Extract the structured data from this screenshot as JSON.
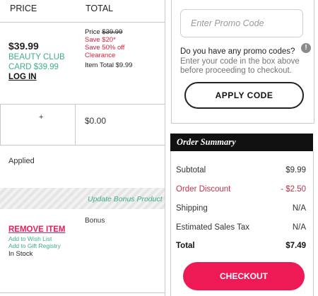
{
  "cart": {
    "headers": {
      "price": "PRICE",
      "total": "TOTAL"
    },
    "item": {
      "sale_price": "$39.99",
      "beauty_club_label": "BEAUTY CLUB",
      "beauty_club_card": "CARD $39.99",
      "login_link": "LOG IN",
      "detail_price_label": "Price",
      "detail_price": "$39.99",
      "save_amount": "Save $20*",
      "save_percent": "Save 50% off",
      "clearance": "Clearance",
      "item_total": "Item Total $9.99"
    },
    "qty_plus": "+",
    "row_total": "$0.00",
    "applied": "Applied",
    "update_bonus": "Update Bonus Product",
    "bonus_label": "Bonus",
    "remove_item": "REMOVE ITEM",
    "add_wish": "Add to Wish List",
    "add_registry": "Add to Gift Registry",
    "stock": "In Stock"
  },
  "promo": {
    "placeholder": "Enter Promo Code",
    "question": "Do you have any promo codes?",
    "info_glyph": "!",
    "help_line1": "Enter your code in the box above",
    "help_line2": "before proceeding to checkout.",
    "apply_label": "APPLY CODE"
  },
  "summary": {
    "title": "Order Summary",
    "rows": [
      {
        "label": "Subtotal",
        "value": "$9.99"
      },
      {
        "label": "Order Discount",
        "value": "- $2.50"
      },
      {
        "label": "Shipping",
        "value": "N/A"
      },
      {
        "label": "Estimated Sales Tax",
        "value": "N/A"
      },
      {
        "label": "Total",
        "value": "$7.49"
      }
    ],
    "checkout_label": "CHECKOUT"
  },
  "colors": {
    "accent": "#ee1a56",
    "discount": "#d8213e",
    "beauty_club": "#3fae87"
  }
}
